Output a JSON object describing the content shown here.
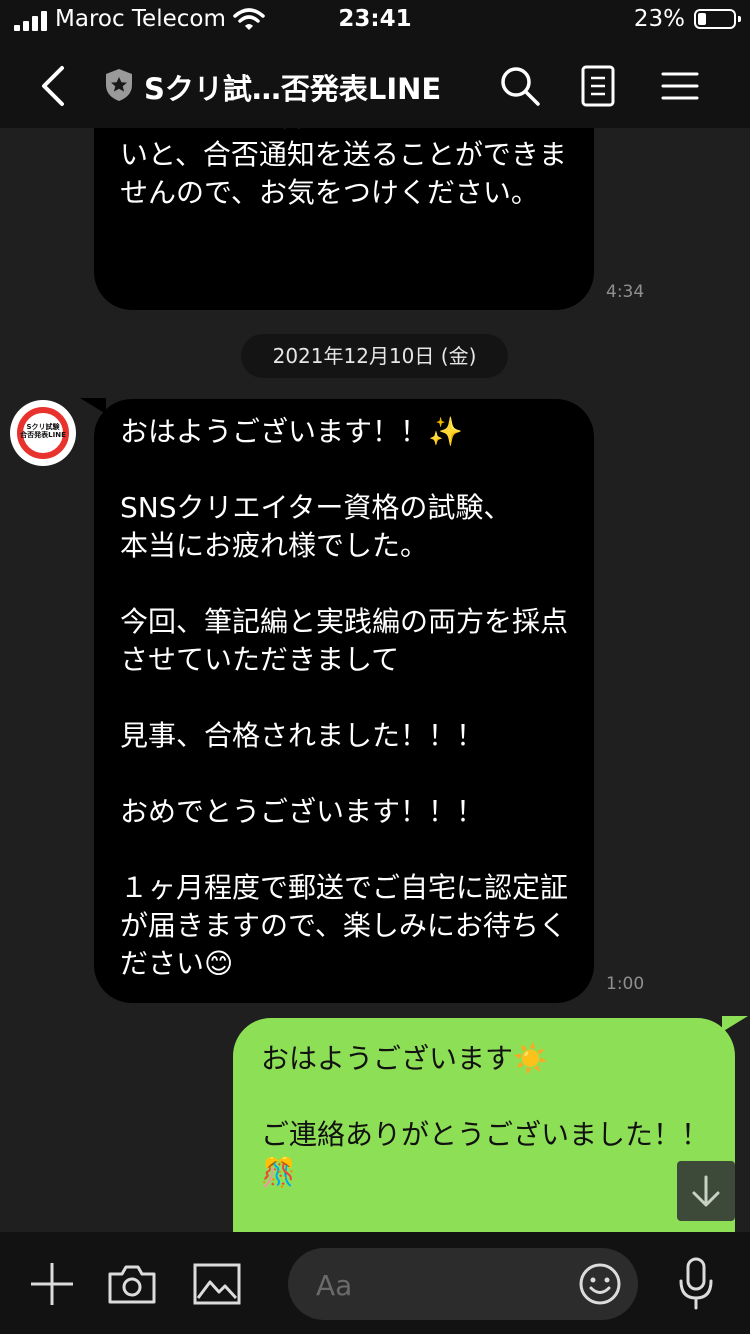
{
  "status_bar": {
    "carrier": "Maroc Telecom",
    "time": "23:41",
    "battery_percent": "23%",
    "battery_level": 0.23
  },
  "header": {
    "title": "Sクリ試…否発表LINE",
    "icons": [
      "back-chevron-icon",
      "shield-star-icon",
      "search-icon",
      "notes-icon",
      "menu-icon"
    ]
  },
  "messages": {
    "previous": {
      "text": "※スタンプを送っていただけていないと、合否通知を送ることができませんので、お気をつけください。",
      "time": "4:34"
    },
    "date_divider": "2021年12月10日 (金)",
    "incoming": {
      "avatar_logo_line1": "Sクリ試験",
      "avatar_logo_line2": "合否発表LINE",
      "text": "おはようございます！！✨\n\nSNSクリエイター資格の試験、\n本当にお疲れ様でした。\n\n今回、筆記編と実践編の両方を採点させていただきまして\n\n見事、合格されました！！！\n\nおめでとうございます！！！\n\n１ヶ月程度で郵送でご自宅に認定証が届きますので、楽しみにお待ちください😊",
      "time": "1:00"
    },
    "outgoing": {
      "text": "おはようございます☀️\n\nご連絡ありがとうございました！！🎊"
    }
  },
  "composer": {
    "placeholder": "Aa",
    "icons": [
      "plus-icon",
      "camera-icon",
      "image-icon",
      "emoji-icon",
      "microphone-icon"
    ]
  },
  "colors": {
    "background": "#1f1f1f",
    "incoming_bubble": "#000000",
    "outgoing_bubble": "#8de055",
    "bar": "#121212"
  }
}
